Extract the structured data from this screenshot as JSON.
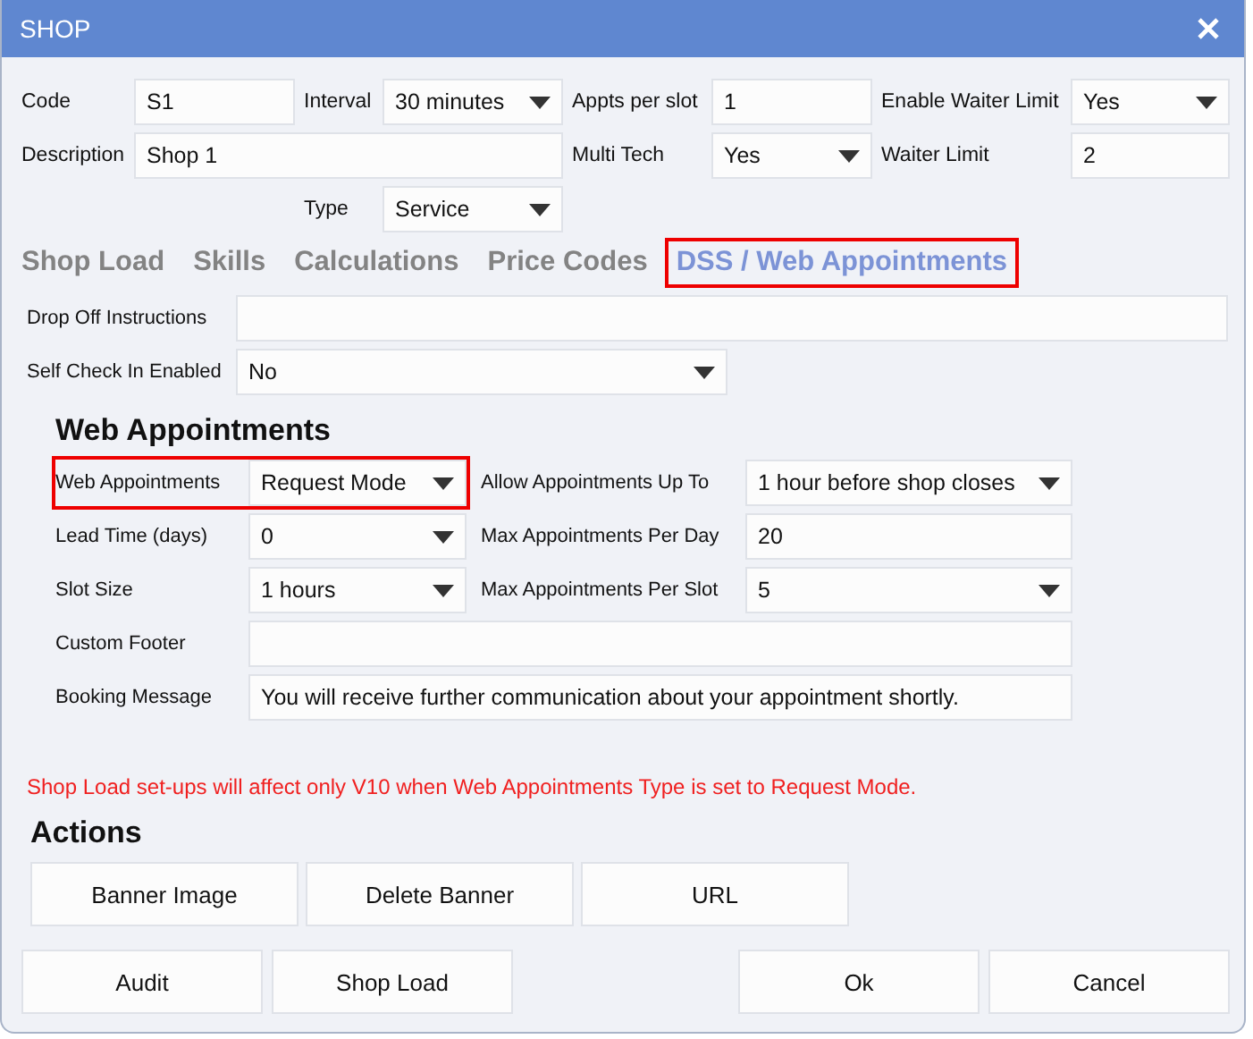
{
  "window": {
    "title": "SHOP"
  },
  "top_form": {
    "code": {
      "label": "Code",
      "value": "S1",
      "kind": "text"
    },
    "interval": {
      "label": "Interval",
      "value": "30 minutes",
      "kind": "select"
    },
    "appts_per_slot": {
      "label": "Appts per slot",
      "value": "1",
      "kind": "text"
    },
    "enable_waiter_limit": {
      "label": "Enable Waiter Limit",
      "value": "Yes",
      "kind": "select"
    },
    "description": {
      "label": "Description",
      "value": "Shop 1",
      "kind": "text"
    },
    "multi_tech": {
      "label": "Multi Tech",
      "value": "Yes",
      "kind": "select"
    },
    "waiter_limit": {
      "label": "Waiter Limit",
      "value": "2",
      "kind": "text"
    },
    "type": {
      "label": "Type",
      "value": "Service",
      "kind": "select"
    }
  },
  "tabs": [
    {
      "label": "Shop Load",
      "selected": false,
      "highlighted": false
    },
    {
      "label": "Skills",
      "selected": false,
      "highlighted": false
    },
    {
      "label": "Calculations",
      "selected": false,
      "highlighted": false
    },
    {
      "label": "Price Codes",
      "selected": false,
      "highlighted": false
    },
    {
      "label": "DSS / Web Appointments",
      "selected": true,
      "highlighted": true
    }
  ],
  "tab_fields": [
    {
      "label": "Drop Off Instructions",
      "kind": "text"
    },
    {
      "label": "Self Check In Enabled",
      "value": "No",
      "kind": "select"
    }
  ],
  "web_appointments": {
    "heading": "Web Appointments",
    "rows": [
      [
        {
          "label": "Web Appointments",
          "value": "Request Mode",
          "kind": "select",
          "highlighted": true
        },
        {
          "label": "Allow Appointments Up To",
          "value": "1 hour before shop closes",
          "kind": "select",
          "highlighted": false
        }
      ],
      [
        {
          "label": "Lead Time (days)",
          "value": "0",
          "kind": "select",
          "highlighted": false
        },
        {
          "label": "Max Appointments Per Day",
          "value": "20",
          "kind": "text",
          "highlighted": false
        }
      ],
      [
        {
          "label": "Slot Size",
          "value": "1 hours",
          "kind": "select",
          "highlighted": false
        },
        {
          "label": "Max Appointments Per Slot",
          "value": "5",
          "kind": "select",
          "highlighted": false
        }
      ],
      [
        {
          "label": "Custom Footer",
          "kind": "text",
          "highlighted": false
        }
      ],
      [
        {
          "label": "Booking Message",
          "value": "You will receive further communication about your appointment shortly.",
          "kind": "text",
          "highlighted": false
        }
      ]
    ]
  },
  "warning": "Shop Load set-ups will affect only V10 when Web Appointments Type is set to Request Mode.",
  "actions": {
    "heading": "Actions",
    "buttons": [
      "Banner Image",
      "Delete Banner",
      "URL"
    ]
  },
  "footer": {
    "left_buttons": [
      "Audit",
      "Shop Load"
    ],
    "right_buttons": [
      "Ok",
      "Cancel"
    ]
  }
}
